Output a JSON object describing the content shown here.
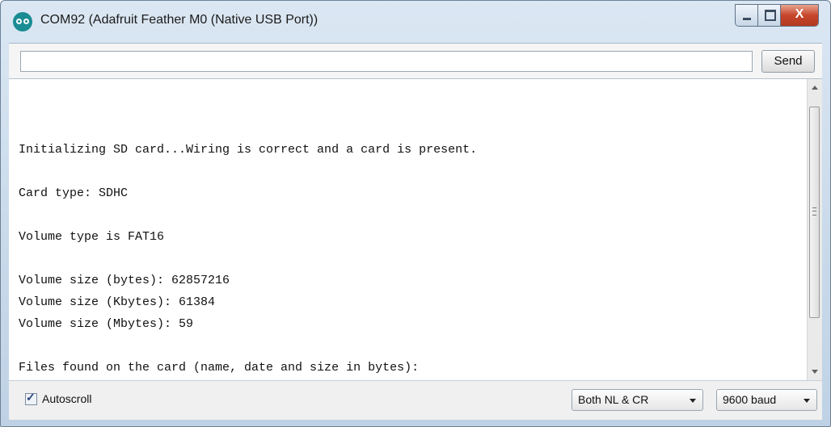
{
  "window": {
    "title": "COM92 (Adafruit Feather M0 (Native USB Port))",
    "close_label": "X"
  },
  "input_row": {
    "value": "",
    "send_label": "Send"
  },
  "console": {
    "lines": [
      "",
      "Initializing SD card...Wiring is correct and a card is present.",
      "",
      "Card type: SDHC",
      "",
      "Volume type is FAT16",
      "",
      "Volume size (bytes): 62857216",
      "Volume size (Kbytes): 61384",
      "Volume size (Mbytes): 59",
      "",
      "Files found on the card (name, date and size in bytes):"
    ]
  },
  "bottom_bar": {
    "autoscroll_label": "Autoscroll",
    "autoscroll_checked": true,
    "line_ending": "Both NL & CR",
    "baud_rate": "9600 baud"
  },
  "icons": {
    "app": "arduino-logo-icon",
    "minimize": "minimize-icon",
    "maximize": "maximize-icon",
    "close": "close-icon"
  },
  "colors": {
    "title_bar": "#c8d9ea",
    "close_button": "#c6452b",
    "app_icon": "#1a8c93"
  }
}
